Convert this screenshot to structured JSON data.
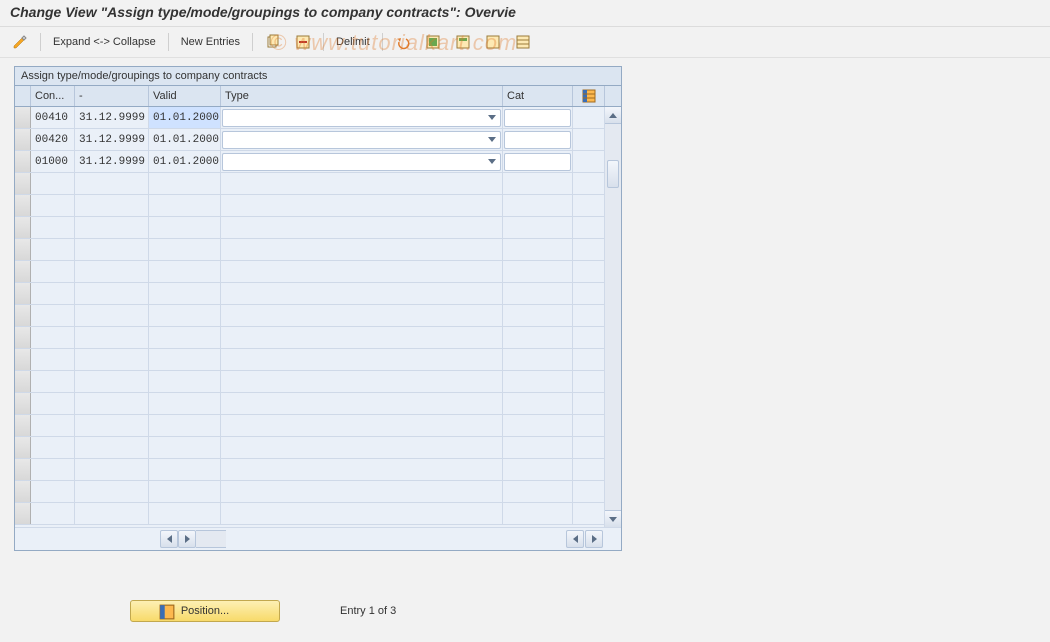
{
  "header": {
    "title": "Change View \"Assign type/mode/groupings to company contracts\": Overvie"
  },
  "toolbar": {
    "expand_collapse_label": "Expand <-> Collapse",
    "new_entries_label": "New Entries",
    "delimit_label": "Delimit"
  },
  "grid": {
    "title": "Assign type/mode/groupings to company contracts",
    "columns": {
      "con": "Con...",
      "to": "-",
      "valid": "Valid",
      "type": "Type",
      "cat": "Cat"
    },
    "rows": [
      {
        "con": "00410",
        "to": "31.12.9999",
        "valid": "01.01.2000",
        "type": "",
        "cat": ""
      },
      {
        "con": "00420",
        "to": "31.12.9999",
        "valid": "01.01.2000",
        "type": "",
        "cat": ""
      },
      {
        "con": "01000",
        "to": "31.12.9999",
        "valid": "01.01.2000",
        "type": "",
        "cat": ""
      }
    ],
    "empty_rows": 16
  },
  "footer": {
    "position_label": "Position...",
    "entry_text": "Entry 1 of 3"
  },
  "watermark": "© www.tutorialkart.com"
}
